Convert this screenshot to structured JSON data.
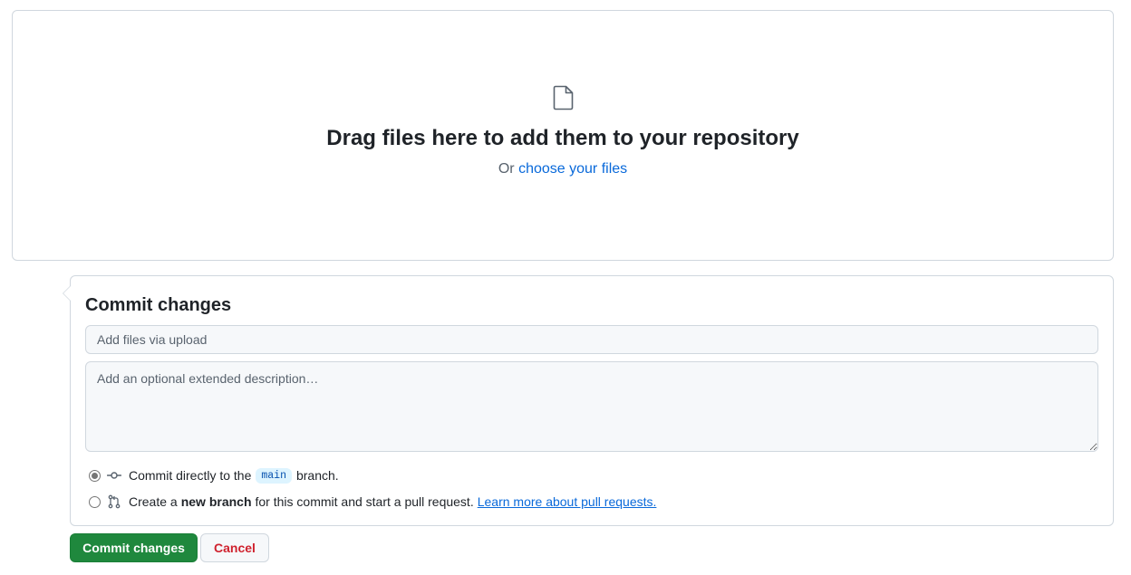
{
  "dropzone": {
    "title": "Drag files here to add them to your repository",
    "or_text": "Or",
    "choose_link": "choose your files"
  },
  "commit": {
    "title": "Commit changes",
    "summary_placeholder": "Add files via upload",
    "description_placeholder": "Add an optional extended description…",
    "option_direct": {
      "prefix": "Commit directly to the",
      "branch": "main",
      "suffix": "branch.",
      "selected": true
    },
    "option_new_branch": {
      "prefix": "Create a",
      "bold": "new branch",
      "suffix": "for this commit and start a pull request.",
      "link": "Learn more about pull requests.",
      "selected": false
    }
  },
  "buttons": {
    "commit": "Commit changes",
    "cancel": "Cancel"
  },
  "colors": {
    "primary_green": "#1f883d",
    "link_blue": "#0969da",
    "danger_red": "#cf222e",
    "border": "#d0d7de"
  },
  "icons": {
    "dropzone": "file-icon",
    "direct_commit": "git-commit-icon",
    "new_branch": "git-pull-request-icon"
  }
}
